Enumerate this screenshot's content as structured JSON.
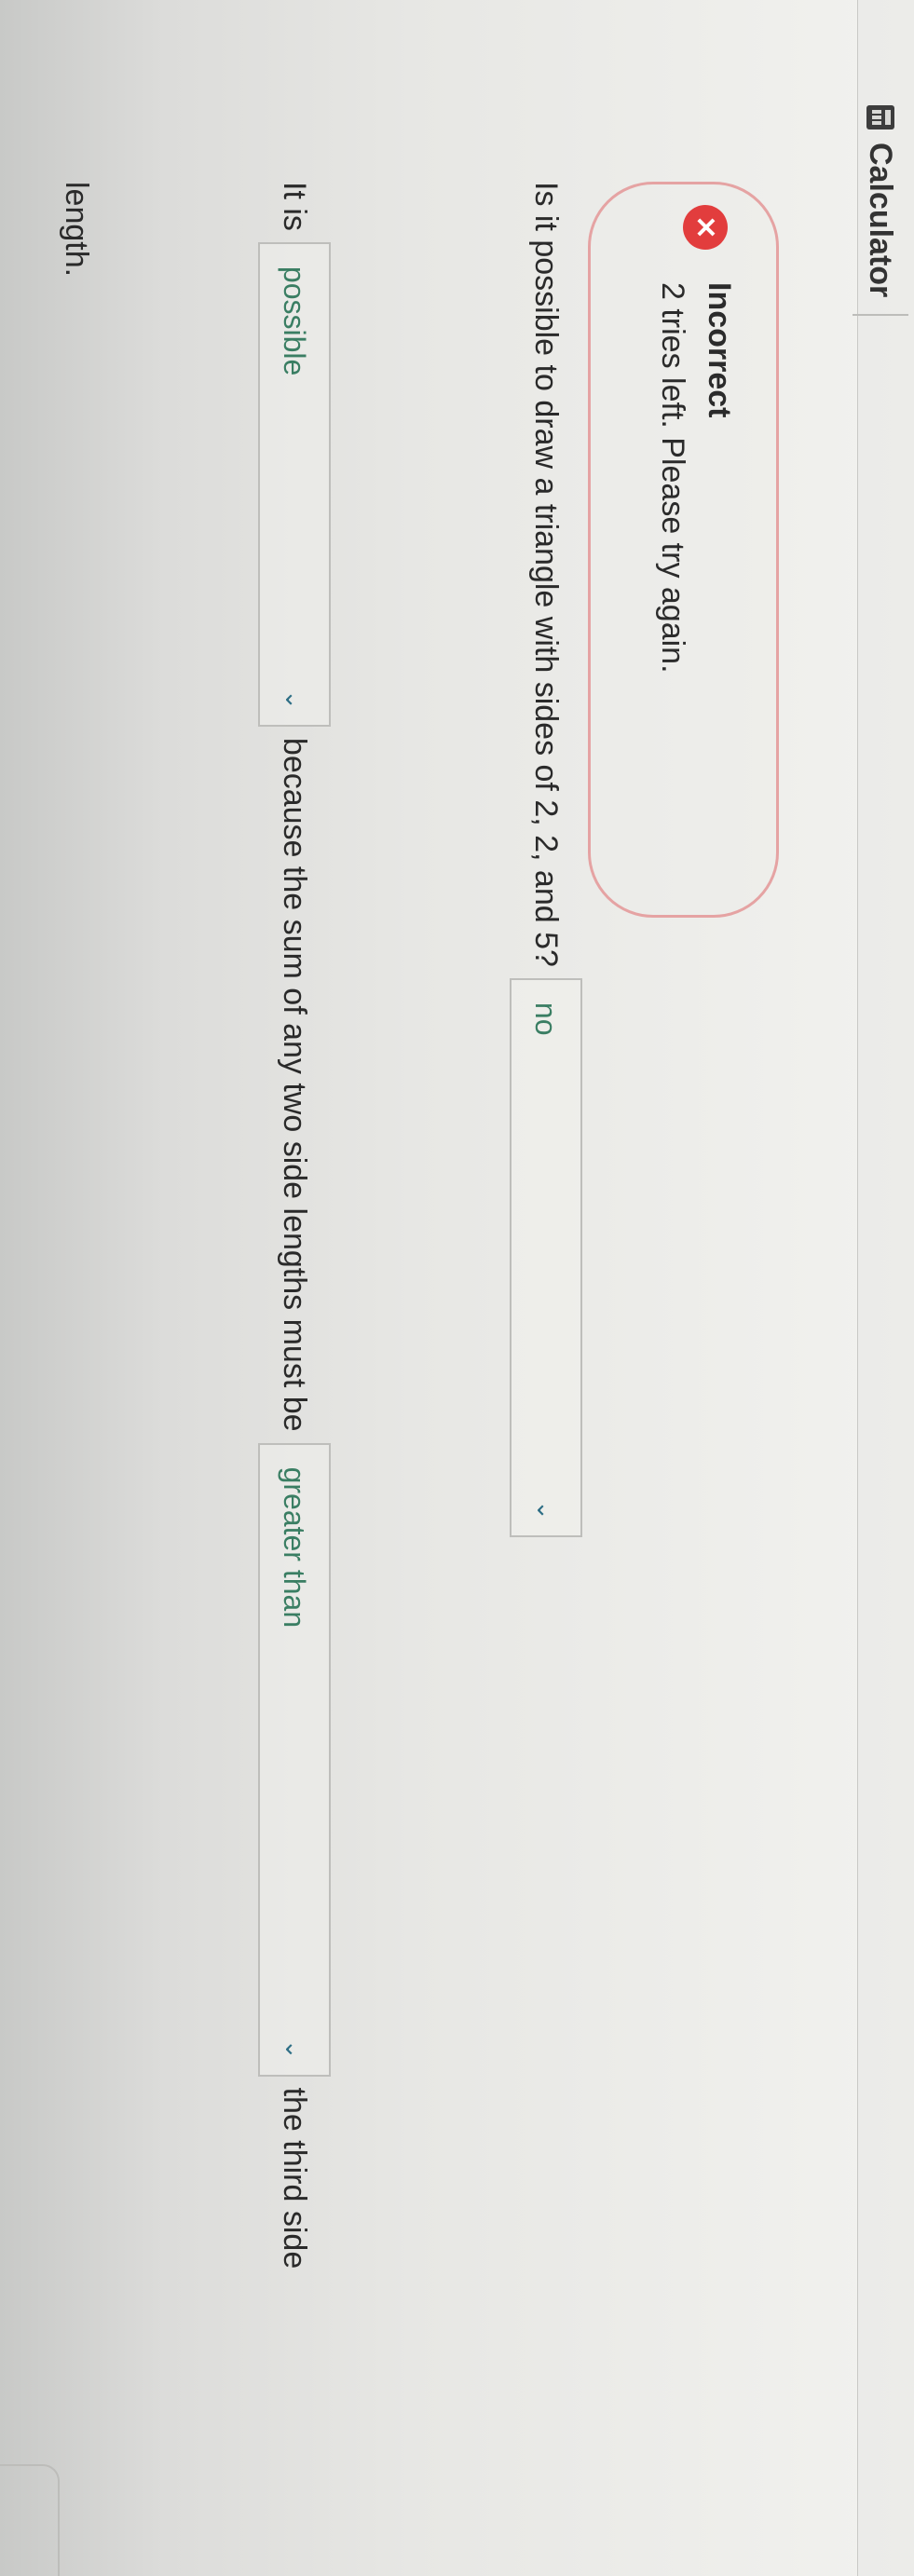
{
  "toolbar": {
    "calculator_label": "Calculator",
    "calculator_icon": "calculator-icon"
  },
  "feedback": {
    "status_icon": "x-icon",
    "status_color": "#e23d3d",
    "border_color": "#e5a3a3",
    "title": "Incorrect",
    "message": "2 tries left. Please try again."
  },
  "question": {
    "prompt": "Is it possible to draw a triangle with sides of 2, 2, and 5?",
    "answer_dropdown": {
      "selected": "no"
    }
  },
  "explanation": {
    "prefix": "It is",
    "dropdown_1": {
      "selected": "possible"
    },
    "middle": "because the sum of any two side lengths must be",
    "dropdown_2": {
      "selected": "greater than"
    },
    "suffix": "the third side",
    "suffix_line2": "length."
  },
  "colors": {
    "dropdown_text": "#3a7e63",
    "chevron": "#2f6f86"
  }
}
